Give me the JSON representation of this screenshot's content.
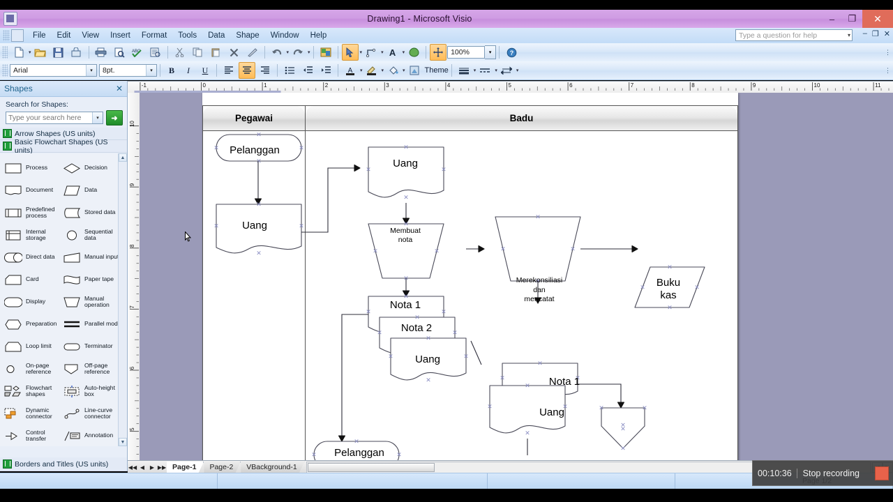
{
  "window": {
    "title": "Drawing1 - Microsoft Visio",
    "app_icon": "visio-icon",
    "minimize": "–",
    "restore": "❐",
    "close": "✕"
  },
  "menu": {
    "items": [
      {
        "label": "File"
      },
      {
        "label": "Edit"
      },
      {
        "label": "View"
      },
      {
        "label": "Insert"
      },
      {
        "label": "Format"
      },
      {
        "label": "Tools"
      },
      {
        "label": "Data"
      },
      {
        "label": "Shape"
      },
      {
        "label": "Window"
      },
      {
        "label": "Help"
      }
    ],
    "help_placeholder": "Type a question for help",
    "window_buttons": [
      "–",
      "❐",
      "✕"
    ]
  },
  "toolbar_standard": {
    "buttons": [
      {
        "name": "new-document",
        "glyph": "🗋"
      },
      {
        "name": "open",
        "glyph": "📂"
      },
      {
        "name": "save",
        "glyph": "💾"
      },
      {
        "name": "permission",
        "glyph": "🔒"
      },
      {
        "name": "print",
        "glyph": "🖨"
      },
      {
        "name": "print-preview",
        "glyph": "🔍"
      },
      {
        "name": "spelling",
        "glyph": "ABC"
      },
      {
        "name": "research",
        "glyph": "📑"
      },
      {
        "name": "cut",
        "glyph": "✂"
      },
      {
        "name": "copy",
        "glyph": "⧉"
      },
      {
        "name": "paste",
        "glyph": "📋"
      },
      {
        "name": "delete",
        "glyph": "✕"
      },
      {
        "name": "format-painter",
        "glyph": "✎"
      },
      {
        "name": "undo",
        "glyph": "↩"
      },
      {
        "name": "redo",
        "glyph": "↪"
      },
      {
        "name": "insert-picture",
        "glyph": "🖼"
      },
      {
        "name": "pointer-tool",
        "glyph": "➤"
      },
      {
        "name": "connector-tool",
        "glyph": "⌐"
      },
      {
        "name": "text-tool",
        "glyph": "A"
      },
      {
        "name": "format-painter-2",
        "glyph": "◆"
      },
      {
        "name": "pan-zoom",
        "glyph": "✥"
      },
      {
        "name": "help",
        "glyph": "?"
      }
    ],
    "zoom_value": "100%"
  },
  "toolbar_format": {
    "font_name": "Arial",
    "font_size": "8pt.",
    "bold": "B",
    "italic": "I",
    "underline": "U",
    "align_left": "≡",
    "align_center": "≡",
    "align_right": "≡",
    "bullets": "☰",
    "decrease_indent": "⇤",
    "increase_indent": "⇥",
    "font_color": "A",
    "line_color": "✎",
    "fill_color": "◖",
    "theme_label": "Theme",
    "line_weight": "▬",
    "line_pattern": "▦",
    "line_ends": "⇄"
  },
  "shapes_panel": {
    "title": "Shapes",
    "close": "✕",
    "search_label": "Search for Shapes:",
    "search_placeholder": "Type your search here",
    "search_button": "➜",
    "stencils": [
      {
        "label": "Arrow Shapes (US units)"
      },
      {
        "label": "Basic Flowchart Shapes (US units)"
      }
    ],
    "footer_stencil": "Borders and Titles (US units)",
    "shape_items": [
      {
        "label": "Process",
        "glyph": "rect"
      },
      {
        "label": "Decision",
        "glyph": "diamond"
      },
      {
        "label": "Document",
        "glyph": "document"
      },
      {
        "label": "Data",
        "glyph": "parallelogram"
      },
      {
        "label": "Predefined process",
        "glyph": "predefined"
      },
      {
        "label": "Stored data",
        "glyph": "stored"
      },
      {
        "label": "Internal storage",
        "glyph": "internal"
      },
      {
        "label": "Sequential data",
        "glyph": "circle"
      },
      {
        "label": "Direct data",
        "glyph": "cylinder"
      },
      {
        "label": "Manual input",
        "glyph": "manualinput"
      },
      {
        "label": "Card",
        "glyph": "card"
      },
      {
        "label": "Paper tape",
        "glyph": "papertape"
      },
      {
        "label": "Display",
        "glyph": "display"
      },
      {
        "label": "Manual operation",
        "glyph": "trapezoid"
      },
      {
        "label": "Preparation",
        "glyph": "hexagon"
      },
      {
        "label": "Parallel mode",
        "glyph": "parallel"
      },
      {
        "label": "Loop limit",
        "glyph": "looplimit"
      },
      {
        "label": "Terminator",
        "glyph": "terminator"
      },
      {
        "label": "On-page reference",
        "glyph": "smallcircle"
      },
      {
        "label": "Off-page reference",
        "glyph": "offpage"
      },
      {
        "label": "Flowchart shapes",
        "glyph": "multi"
      },
      {
        "label": "Auto-height box",
        "glyph": "autoheight"
      },
      {
        "label": "Dynamic connector",
        "glyph": "dynamic"
      },
      {
        "label": "Line-curve connector",
        "glyph": "linecurve"
      },
      {
        "label": "Control transfer",
        "glyph": "controltransfer"
      },
      {
        "label": "Annotation",
        "glyph": "annotation"
      }
    ]
  },
  "rulers": {
    "horizontal_ticks": [
      "-1",
      "0",
      "1",
      "2",
      "3",
      "4",
      "5",
      "6",
      "7",
      "8",
      "9",
      "10"
    ],
    "vertical_ticks": [
      "10",
      "9",
      "8",
      "7",
      "6",
      "5"
    ]
  },
  "diagram": {
    "lanes": [
      {
        "title": "Pegawai"
      },
      {
        "title": "Badu"
      }
    ],
    "nodes": [
      {
        "id": "n1",
        "label": "Pelanggan",
        "shape": "terminator"
      },
      {
        "id": "n2",
        "label": "Uang",
        "shape": "document"
      },
      {
        "id": "n3",
        "label": "Uang",
        "shape": "document"
      },
      {
        "id": "n4",
        "label": "Membuat nota",
        "shape": "manual-operation"
      },
      {
        "id": "n5",
        "label": "Nota 1",
        "shape": "document"
      },
      {
        "id": "n6",
        "label": "Nota 2",
        "shape": "document"
      },
      {
        "id": "n7",
        "label": "Uang",
        "shape": "document"
      },
      {
        "id": "n8",
        "label": "Merekonsiliasi dan mencatat",
        "shape": "manual-operation"
      },
      {
        "id": "n9",
        "label": "Buku kas",
        "shape": "data"
      },
      {
        "id": "n10",
        "label": "Nota 1",
        "shape": "document"
      },
      {
        "id": "n11",
        "label": "Uang",
        "shape": "document"
      },
      {
        "id": "n12",
        "label": "",
        "shape": "off-page-reference"
      },
      {
        "id": "n13",
        "label": "Pelanggan",
        "shape": "terminator"
      }
    ]
  },
  "page_tabs": {
    "nav_first": "◀◀",
    "nav_prev": "◀",
    "nav_next": "▶",
    "nav_last": "▶▶",
    "tabs": [
      {
        "label": "Page-1",
        "active": true
      },
      {
        "label": "Page-2",
        "active": false
      },
      {
        "label": "VBackground-1",
        "active": false
      }
    ]
  },
  "status": {
    "page_count": "Page 1/2"
  },
  "recording": {
    "time": "00:10:36",
    "label": "Stop recording",
    "stop_icon": "stop-square"
  },
  "colors": {
    "title_bar": "#cf9ce3",
    "close_button": "#e06c5a",
    "toolbar": "#d6e6f8",
    "highlight": "#ffbc57",
    "canvas_bg": "#9a9ab8",
    "connection_point": "#8b8fc4",
    "recording_bg": "#3e3e3e",
    "stop_red": "#e8624a"
  }
}
